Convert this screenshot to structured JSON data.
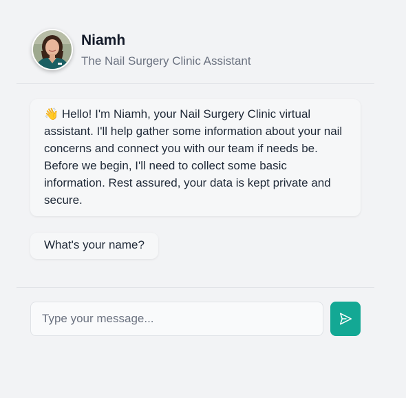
{
  "header": {
    "name": "Niamh",
    "subtitle": "The Nail Surgery Clinic Assistant",
    "avatar_icon": "nurse-avatar"
  },
  "messages": [
    {
      "sender": "assistant",
      "emoji": "👋",
      "text": "Hello! I'm Niamh, your Nail Surgery Clinic virtual assistant. I'll help gather some information about your nail concerns and connect you with our team if needs be. Before we begin, I'll need to collect some basic information. Rest assured, your data is kept private and secure."
    },
    {
      "sender": "assistant",
      "text": "What's your name?"
    }
  ],
  "composer": {
    "placeholder": "Type your message...",
    "value": "",
    "send_icon": "send-icon"
  },
  "colors": {
    "accent": "#13a894",
    "background": "#f2f3f5",
    "bubble": "#f6f7f8"
  }
}
